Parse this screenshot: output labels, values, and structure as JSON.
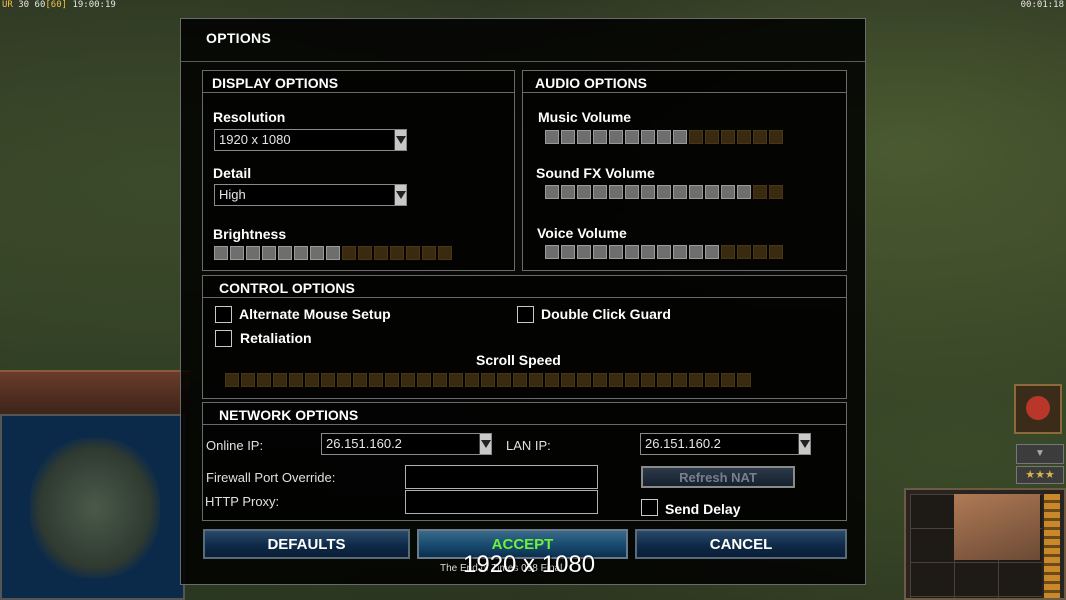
{
  "hud": {
    "top_left_prefix": "UR",
    "top_left_fps": "30 60",
    "top_left_max": "[60]",
    "top_left_time": "19:00:19",
    "top_right_time": "00:01:18",
    "stars": "★★★",
    "arrow": "▼"
  },
  "dialog": {
    "title": "OPTIONS",
    "display": {
      "header": "DISPLAY OPTIONS",
      "resolution_label": "Resolution",
      "resolution_value": "1920 x 1080",
      "detail_label": "Detail",
      "detail_value": "High",
      "brightness_label": "Brightness",
      "brightness_level": 0.5
    },
    "audio": {
      "header": "AUDIO OPTIONS",
      "music_label": "Music Volume",
      "music_level": 0.6,
      "sfx_label": "Sound FX Volume",
      "sfx_level": 0.87,
      "voice_label": "Voice Volume",
      "voice_level": 0.73
    },
    "control": {
      "header": "CONTROL OPTIONS",
      "alt_mouse_label": "Alternate Mouse Setup",
      "alt_mouse_checked": false,
      "double_click_label": "Double Click Guard",
      "double_click_checked": false,
      "retaliation_label": "Retaliation",
      "retaliation_checked": false,
      "scroll_label": "Scroll Speed",
      "scroll_level": 0.0
    },
    "network": {
      "header": "NETWORK OPTIONS",
      "online_ip_label": "Online IP:",
      "online_ip_value": "26.151.160.2",
      "lan_ip_label": "LAN IP:",
      "lan_ip_value": "26.151.160.2",
      "firewall_label": "Firewall Port Override:",
      "firewall_value": "",
      "proxy_label": "HTTP Proxy:",
      "proxy_value": "",
      "refresh_nat_label": "Refresh NAT",
      "send_delay_label": "Send Delay",
      "send_delay_checked": false
    },
    "buttons": {
      "defaults": "DEFAULTS",
      "accept": "ACCEPT",
      "cancel": "CANCEL"
    },
    "footer_text": "The End of Times 098 Final",
    "resolution_overlay": "1920 x 1080"
  },
  "colors": {
    "slider_on": "#6e6e6e",
    "slider_off": "#3a2a10",
    "accept_text": "#6cf23a"
  }
}
